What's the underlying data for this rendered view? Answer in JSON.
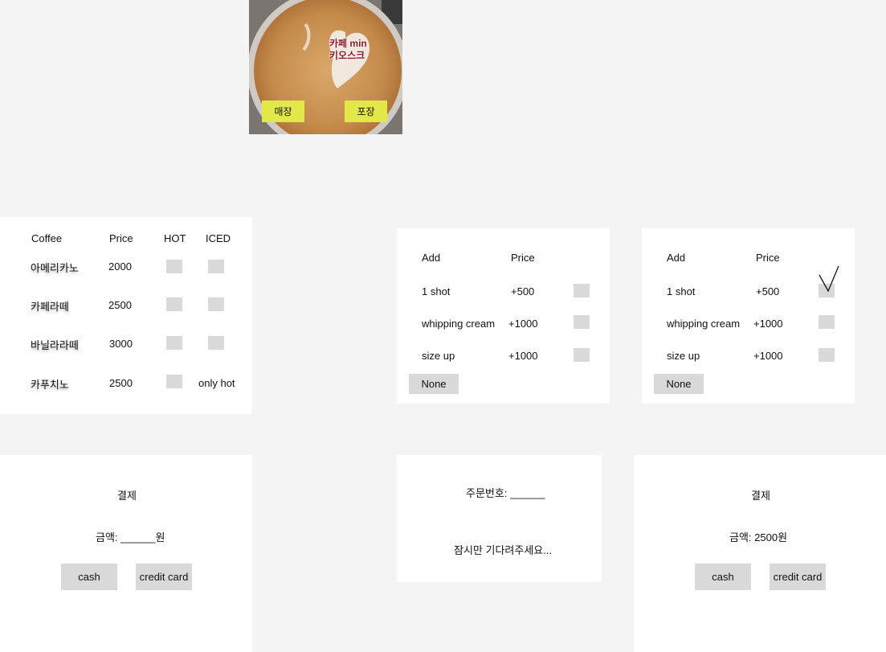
{
  "colors": {
    "background": "#f4f4f4",
    "panel": "#ffffff",
    "checkbox": "#d9d9d9",
    "accent_button": "#e2e848"
  },
  "splash": {
    "logo_line1": "카페 min",
    "logo_line2": "키오스크",
    "dine_in": "매장",
    "takeout": "포장"
  },
  "menu": {
    "headers": {
      "coffee": "Coffee",
      "price": "Price",
      "hot": "HOT",
      "iced": "ICED"
    },
    "items": [
      {
        "name": "아메리카노",
        "price": "2000"
      },
      {
        "name": "카페라떼",
        "price": "2500"
      },
      {
        "name": "바닐라라떼",
        "price": "3000"
      },
      {
        "name": "카푸치노",
        "price": "2500",
        "iced_note": "only hot"
      }
    ]
  },
  "addons_a": {
    "headers": {
      "add": "Add",
      "price": "Price"
    },
    "items": [
      {
        "name": "1 shot",
        "price": "+500"
      },
      {
        "name": "whipping cream",
        "price": "+1000"
      },
      {
        "name": "size up",
        "price": "+1000"
      }
    ],
    "none_label": "None"
  },
  "addons_b": {
    "headers": {
      "add": "Add",
      "price": "Price"
    },
    "items": [
      {
        "name": "1 shot",
        "price": "+500",
        "checked": true
      },
      {
        "name": "whipping cream",
        "price": "+1000"
      },
      {
        "name": "size up",
        "price": "+1000"
      }
    ],
    "none_label": "None"
  },
  "payment_empty": {
    "title": "결제",
    "amount": "금액: ______원",
    "cash": "cash",
    "credit": "credit card"
  },
  "order_wait": {
    "order_number": "주문번호: ______",
    "message": "잠시만 기다려주세요..."
  },
  "payment_filled": {
    "title": "결제",
    "amount": "금액: 2500원",
    "cash": "cash",
    "credit": "credit card"
  }
}
